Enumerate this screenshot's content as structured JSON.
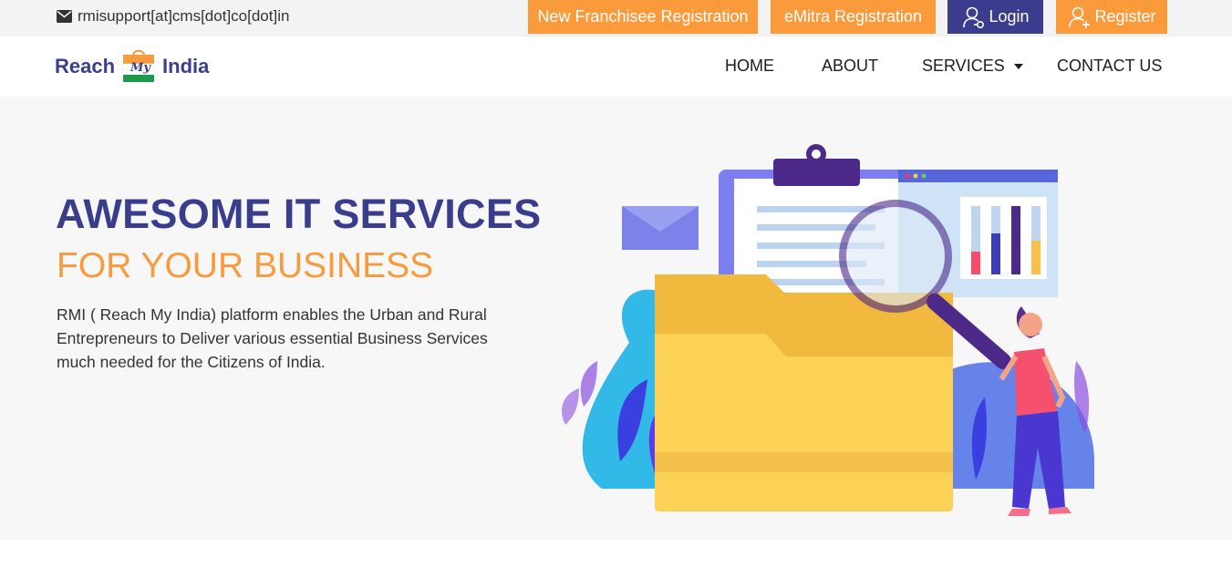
{
  "topbar": {
    "email": "rmisupport[at]cms[dot]co[dot]in",
    "buttons": {
      "franchisee": "New Franchisee Registration",
      "emitra": "eMitra Registration",
      "login": "Login",
      "register": "Register"
    }
  },
  "logo": {
    "word_left": "Reach",
    "word_mid": "My",
    "word_right": "India"
  },
  "nav": {
    "home": "HOME",
    "about": "ABOUT",
    "services": "SERVICES",
    "contact": "CONTACT US"
  },
  "hero": {
    "title": "AWESOME IT SERVICES",
    "subtitle": "FOR YOUR BUSINESS",
    "description": "RMI ( Reach My India) platform enables the Urban and Rural Entrepreneurs to Deliver various essential Business Services much needed for the Citizens of India."
  },
  "colors": {
    "brand_navy": "#3b3c8e",
    "brand_orange": "#fb9a3b",
    "hero_bg": "#f7f7f7"
  },
  "icons": [
    "envelope-icon",
    "user-login-icon",
    "user-add-icon",
    "caret-down-icon"
  ]
}
